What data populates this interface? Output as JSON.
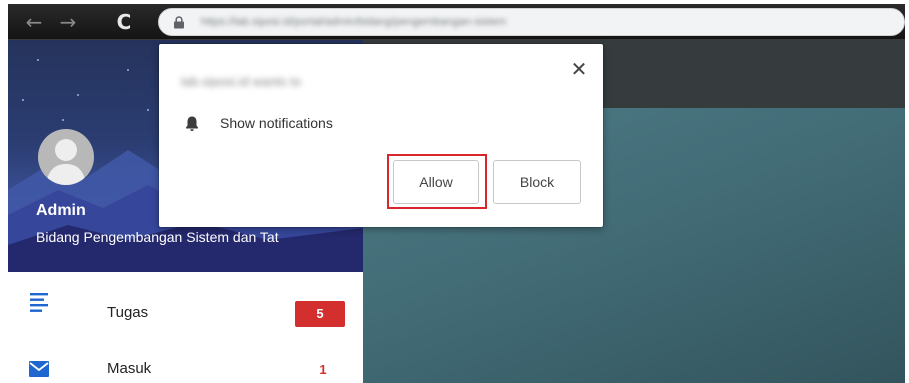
{
  "browser": {
    "url": "https://lab.siposi.id/portal/admin/bidang/pengembangan-sistem",
    "url_note_obscured": true
  },
  "sidebar": {
    "user_name": "Admin",
    "user_role": "Bidang Pengembangan Sistem dan Tat",
    "menu": [
      {
        "label": "Tugas",
        "count": "5"
      },
      {
        "label": "Masuk",
        "count": "1"
      }
    ]
  },
  "popup": {
    "origin": "lab.siposi.id wants to",
    "permission_text": "Show notifications",
    "allow_label": "Allow",
    "block_label": "Block",
    "close_symbol": "✕"
  },
  "colors": {
    "accent_red": "#d32f2f",
    "highlight_red": "#d9262c",
    "sidebar_blue": "#2b3d72",
    "menu_icon_blue": "#1e66d0"
  },
  "icons": {
    "back": "←",
    "forward": "→",
    "reload": "C"
  }
}
